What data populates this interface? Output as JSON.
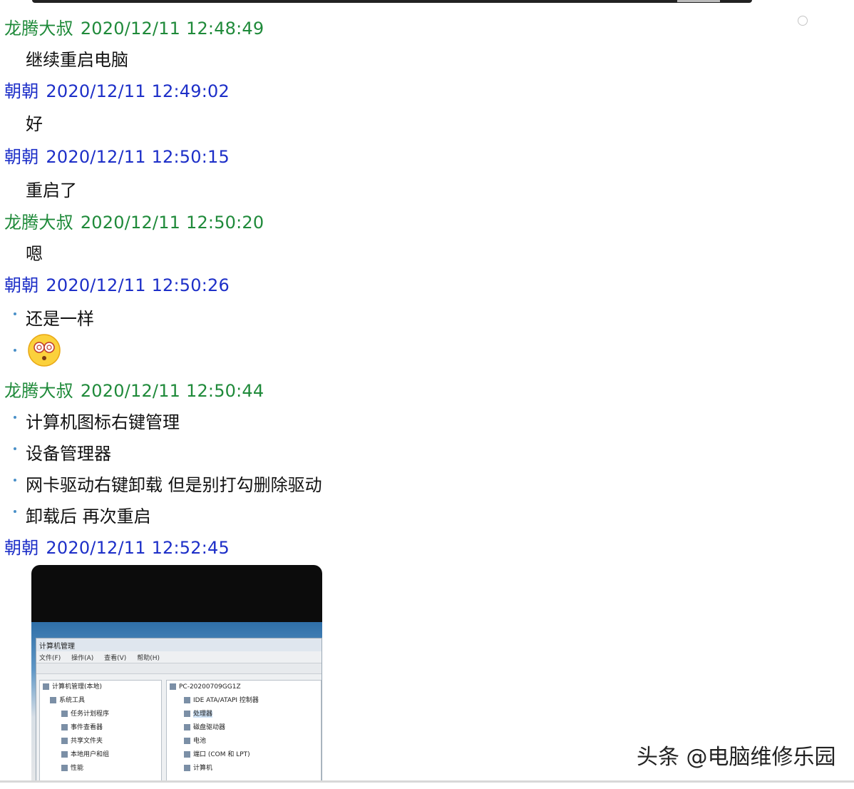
{
  "messages": [
    {
      "sender": "龙腾大叔",
      "time": "2020/12/11 12:48:49",
      "lines": [
        "继续重启电脑"
      ]
    },
    {
      "sender": "朝朝",
      "time": "2020/12/11 12:49:02",
      "lines": [
        "好"
      ]
    },
    {
      "sender": "朝朝",
      "time": "2020/12/11 12:50:15",
      "lines": [
        "重启了"
      ]
    },
    {
      "sender": "龙腾大叔",
      "time": "2020/12/11 12:50:20",
      "lines": [
        "嗯"
      ]
    },
    {
      "sender": "朝朝",
      "time": "2020/12/11 12:50:26",
      "lines": [
        "还是一样"
      ]
    },
    {
      "sender": "龙腾大叔",
      "time": "2020/12/11 12:50:44",
      "lines": [
        "计算机图标右键管理",
        "设备管理器",
        "网卡驱动右键卸载 但是别打勾删除驱动",
        "卸载后 再次重启"
      ]
    },
    {
      "sender": "朝朝",
      "time": "2020/12/11 12:52:45",
      "lines": []
    }
  ],
  "screenshot": {
    "window_title": "计算机管理",
    "menu": [
      "文件(F)",
      "操作(A)",
      "查看(V)",
      "帮助(H)"
    ],
    "left_tree": [
      "计算机管理(本地)",
      "系统工具",
      "任务计划程序",
      "事件查看器",
      "共享文件夹",
      "本地用户和组",
      "性能"
    ],
    "right_tree": [
      "PC-20200709GG1Z",
      "IDE ATA/ATAPI 控制器",
      "处理器",
      "磁盘驱动器",
      "电池",
      "端口 (COM 和 LPT)",
      "计算机"
    ]
  },
  "watermark": "头条 @电脑维修乐园",
  "colors": {
    "green_sender": "#1f8a3a",
    "blue_sender": "#1d2fc8",
    "bullet": "#4a90c8"
  },
  "icons": {
    "emoji": "dizzy-face-emoji"
  }
}
